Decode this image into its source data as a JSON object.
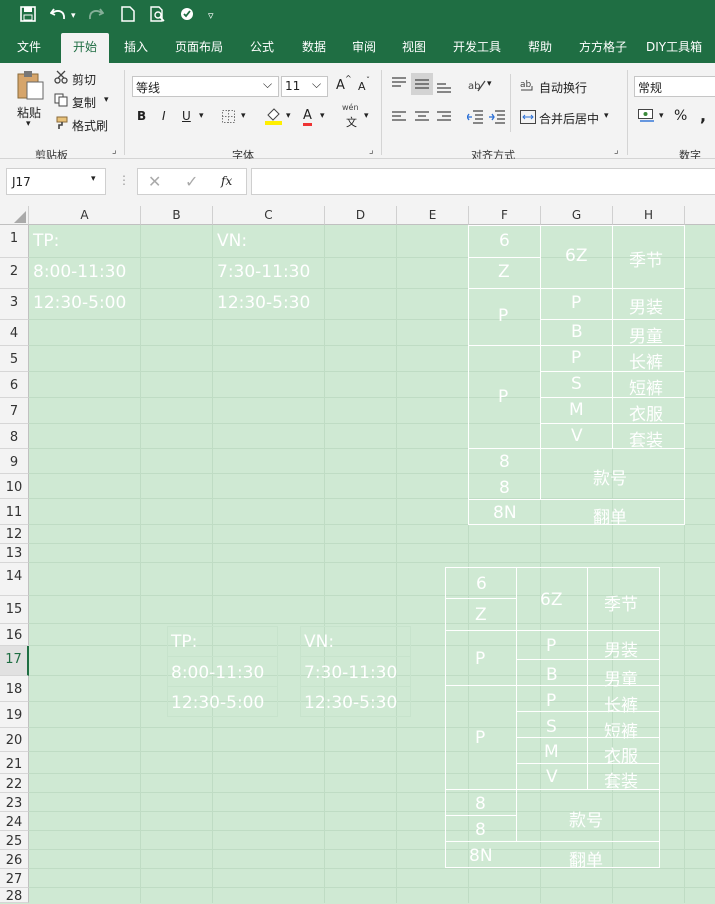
{
  "qat": {
    "icons": [
      "save-icon",
      "undo-icon",
      "redo-icon",
      "new-icon",
      "print-preview-icon",
      "touch-mode-icon",
      "customize-icon"
    ]
  },
  "tabs": [
    "文件",
    "开始",
    "插入",
    "页面布局",
    "公式",
    "数据",
    "审阅",
    "视图",
    "开发工具",
    "帮助",
    "方方格子",
    "DIY工具箱"
  ],
  "ribbon": {
    "clipboard": {
      "paste": "粘贴",
      "cut": "剪切",
      "copy": "复制",
      "format_painter": "格式刷",
      "group": "剪贴板"
    },
    "font": {
      "name": "等线",
      "size": "11",
      "bold": "B",
      "italic": "I",
      "underline": "U",
      "group": "字体",
      "wen": "wén",
      "wen_zi": "文",
      "grow": "A",
      "shrink": "A",
      "fontcolor": "A"
    },
    "align": {
      "wrap": "自动换行",
      "merge": "合并后居中",
      "group": "对齐方式"
    },
    "number": {
      "format": "常规",
      "percent": "%",
      "comma": ",",
      "group": "数字"
    }
  },
  "formula_bar": {
    "namebox": "J17",
    "fx": "fx",
    "value": ""
  },
  "columns": [
    "A",
    "B",
    "C",
    "D",
    "E",
    "F",
    "G",
    "H"
  ],
  "rows": [
    "1",
    "2",
    "3",
    "4",
    "5",
    "6",
    "7",
    "8",
    "9",
    "10",
    "11",
    "12",
    "13",
    "14",
    "15",
    "16",
    "17",
    "18",
    "19",
    "20",
    "21",
    "22",
    "23",
    "24",
    "25",
    "26",
    "27",
    "28"
  ],
  "cells": {
    "tp": "TP:",
    "vn": "VN:",
    "tp_t1": "8:00-11:30",
    "tp_t2": "12:30-5:00",
    "vn_t1": "7:30-11:30",
    "vn_t2": "12:30-5:30",
    "f_6": "6",
    "f_z": "Z",
    "g_6z": "6Z",
    "h_season": "季节",
    "f_p1": "P",
    "g_p": "P",
    "h_men": "男装",
    "g_b": "B",
    "h_boys": "男童",
    "f_p2": "P",
    "g_p2": "P",
    "h_pants": "长裤",
    "g_s": "S",
    "h_shorts": "短裤",
    "g_m": "M",
    "h_clothes": "衣服",
    "g_v": "V",
    "h_suit": "套装",
    "f_8a": "8",
    "f_8b": "8",
    "g_style": "款号",
    "f_8n": "8N",
    "g_flip": "翻单"
  },
  "colors": {
    "excel_green": "#1f6e43",
    "sheet_bg": "#cfe9d3"
  }
}
